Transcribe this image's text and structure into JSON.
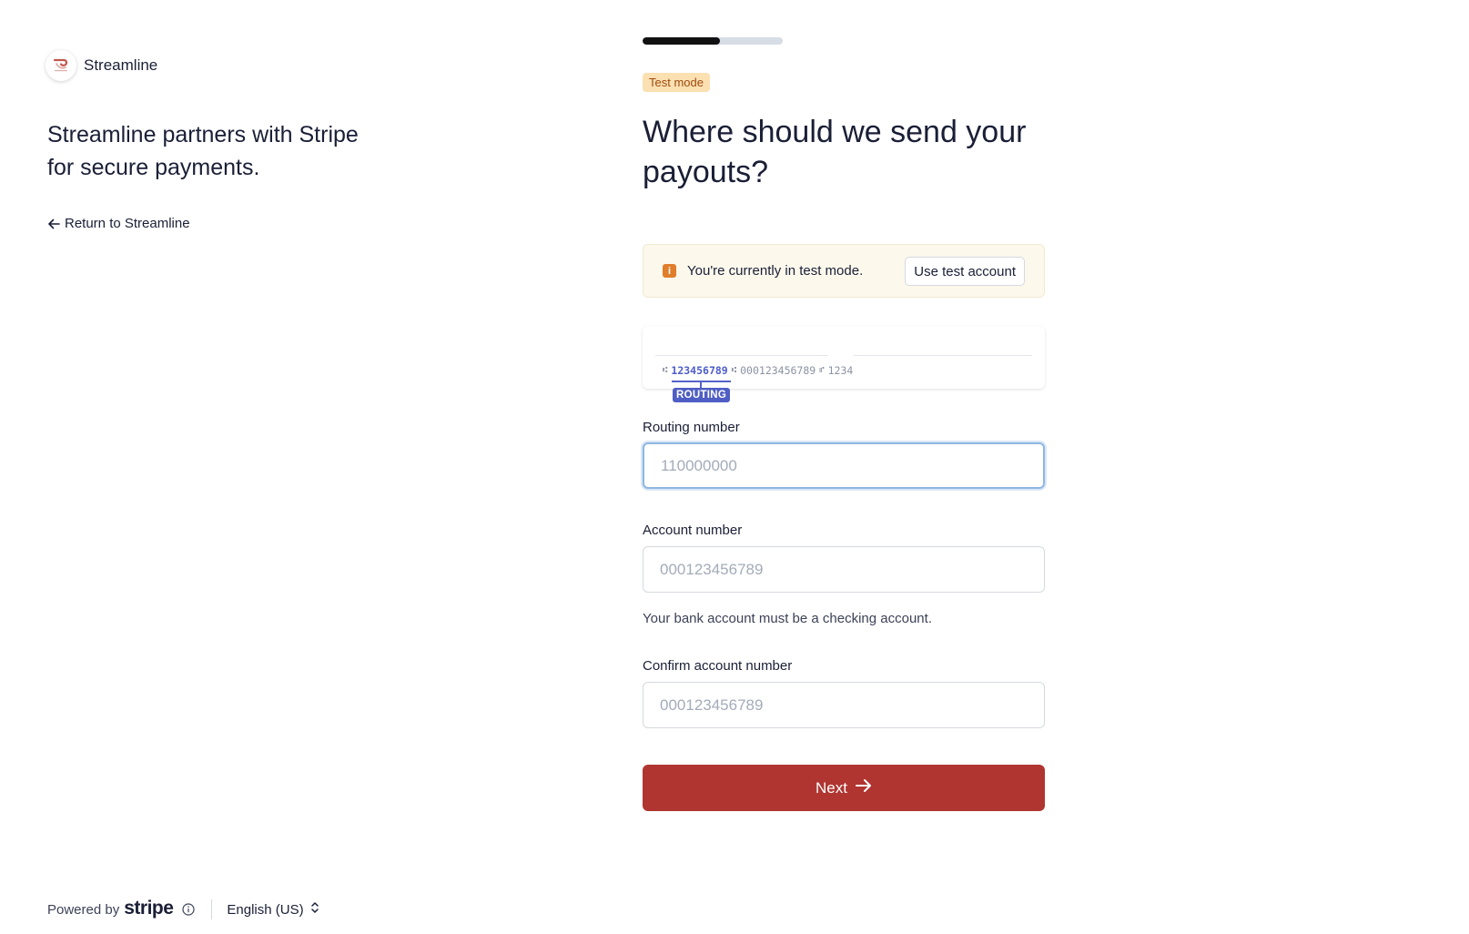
{
  "brand": {
    "name": "Streamline",
    "logo_icon": "streamline-logo-icon",
    "tagline": "Streamline partners with Stripe for secure payments.",
    "return_link": "Return to Streamline"
  },
  "progress": {
    "fraction": 0.55
  },
  "badge": {
    "test_mode": "Test mode"
  },
  "heading": "Where should we send your payouts?",
  "notice": {
    "text": "You're currently in test mode.",
    "button": "Use test account"
  },
  "check_illustration": {
    "routing": "123456789",
    "account": "000123456789",
    "check_number": "1234",
    "tag": "ROUTING"
  },
  "form": {
    "routing": {
      "label": "Routing number",
      "placeholder": "110000000"
    },
    "account": {
      "label": "Account number",
      "placeholder": "000123456789",
      "hint": "Your bank account must be a checking account."
    },
    "confirm": {
      "label": "Confirm account number",
      "placeholder": "000123456789"
    },
    "next_button": "Next"
  },
  "footer": {
    "powered_by": "Powered by",
    "stripe": "stripe",
    "language": "English (US)"
  },
  "colors": {
    "accent": "#b03530",
    "badge_bg": "#fbe0b2",
    "badge_text": "#a04b0d",
    "routing_highlight": "#4f5ec4"
  }
}
